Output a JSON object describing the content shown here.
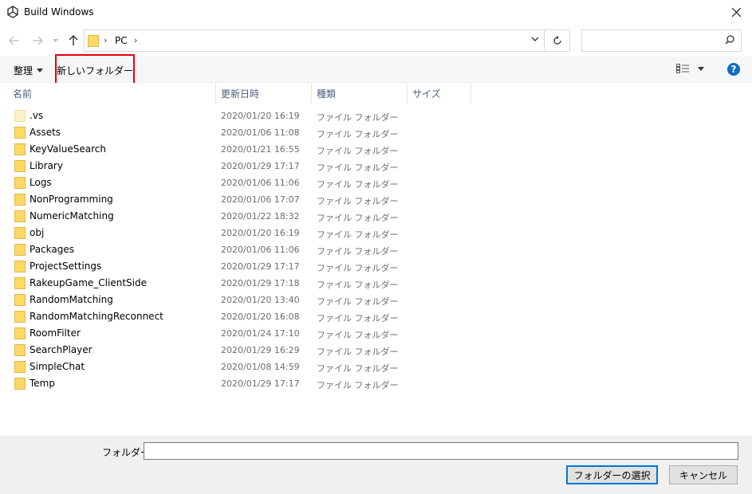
{
  "window": {
    "title": "Build Windows"
  },
  "address": {
    "crumb": "PC",
    "search_placeholder": ""
  },
  "toolbar": {
    "organize_label": "整理",
    "new_folder_label": "新しいフォルダー"
  },
  "columns": {
    "name": "名前",
    "date": "更新日時",
    "type": "種類",
    "size": "サイズ"
  },
  "files": [
    {
      "name": ".vs",
      "date": "2020/01/20 16:19",
      "type": "ファイル フォルダー"
    },
    {
      "name": "Assets",
      "date": "2020/01/06 11:08",
      "type": "ファイル フォルダー"
    },
    {
      "name": "KeyValueSearch",
      "date": "2020/01/21 16:55",
      "type": "ファイル フォルダー"
    },
    {
      "name": "Library",
      "date": "2020/01/29 17:17",
      "type": "ファイル フォルダー"
    },
    {
      "name": "Logs",
      "date": "2020/01/06 11:06",
      "type": "ファイル フォルダー"
    },
    {
      "name": "NonProgramming",
      "date": "2020/01/06 17:07",
      "type": "ファイル フォルダー"
    },
    {
      "name": "NumericMatching",
      "date": "2020/01/22 18:32",
      "type": "ファイル フォルダー"
    },
    {
      "name": "obj",
      "date": "2020/01/20 16:19",
      "type": "ファイル フォルダー"
    },
    {
      "name": "Packages",
      "date": "2020/01/06 11:06",
      "type": "ファイル フォルダー"
    },
    {
      "name": "ProjectSettings",
      "date": "2020/01/29 17:17",
      "type": "ファイル フォルダー"
    },
    {
      "name": "RakeupGame_ClientSide",
      "date": "2020/01/29 17:18",
      "type": "ファイル フォルダー"
    },
    {
      "name": "RandomMatching",
      "date": "2020/01/20 13:40",
      "type": "ファイル フォルダー"
    },
    {
      "name": "RandomMatchingReconnect",
      "date": "2020/01/20 16:08",
      "type": "ファイル フォルダー"
    },
    {
      "name": "RoomFilter",
      "date": "2020/01/24 17:10",
      "type": "ファイル フォルダー"
    },
    {
      "name": "SearchPlayer",
      "date": "2020/01/29 16:29",
      "type": "ファイル フォルダー"
    },
    {
      "name": "SimpleChat",
      "date": "2020/01/08 14:59",
      "type": "ファイル フォルダー"
    },
    {
      "name": "Temp",
      "date": "2020/01/29 17:17",
      "type": "ファイル フォルダー"
    }
  ],
  "footer": {
    "folder_label": "フォルダー:",
    "folder_value": "",
    "select_button": "フォルダーの選択",
    "cancel_button": "キャンセル"
  },
  "colors": {
    "highlight": "#e8000a",
    "folder": "#ffd866",
    "accent": "#0078d7"
  }
}
